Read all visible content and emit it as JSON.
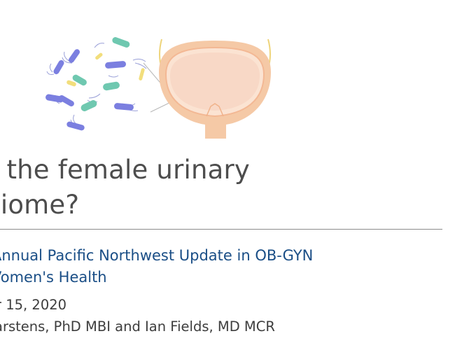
{
  "slide": {
    "title_lines": [
      "s the female urinary",
      "oiome?"
    ],
    "event_lines": [
      "Annual Pacific Northwest Update in OB-GYN",
      "Vomen's Health"
    ],
    "date": "er 15, 2020",
    "authors": "arstens, PhD MBI and Ian Fields, MD MCR"
  },
  "illustration": {
    "icon": "bacteria-and-bladder-illustration",
    "colors": {
      "bacteria_blue": "#7b7fe0",
      "bacteria_teal": "#6fc8b0",
      "bacteria_yellow": "#f2de7c",
      "bladder_outer": "#f5c9a6",
      "bladder_inner": "#f8dccc",
      "ureter_yellow": "#eed47a"
    }
  },
  "colors": {
    "title": "#4d4d4d",
    "event": "#1a4e86",
    "body": "#3d3d3d",
    "rule": "#8c8c8c"
  }
}
